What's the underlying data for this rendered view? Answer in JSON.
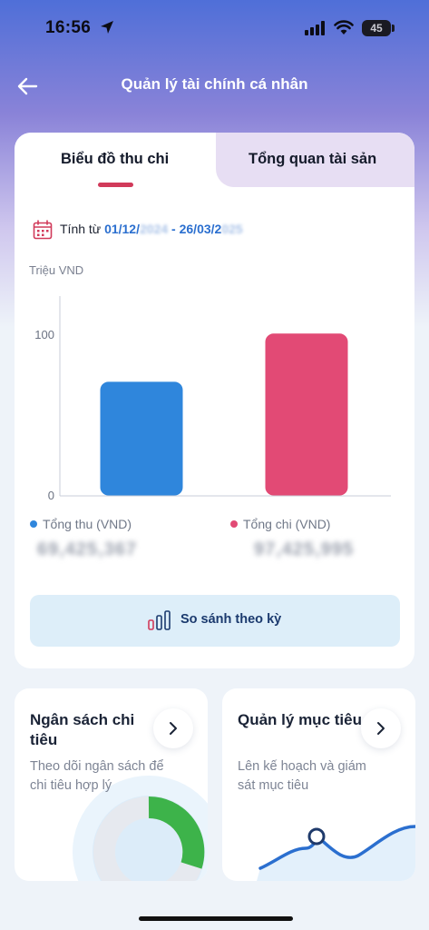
{
  "status_bar": {
    "time": "16:56",
    "battery": "45"
  },
  "header": {
    "title": "Quản lý tài chính cá nhân"
  },
  "tabs": [
    {
      "label": "Biểu đồ thu chi",
      "active": true
    },
    {
      "label": "Tổng quan tài sản",
      "active": false
    }
  ],
  "date_range": {
    "prefix": "Tính từ",
    "start": "01/12/",
    "start_hidden": "2024",
    "sep": " - ",
    "end": "26/03/2",
    "end_hidden": "025"
  },
  "chart_data": {
    "type": "bar",
    "ylabel": "Triệu VND",
    "yticks": [
      0,
      100
    ],
    "ylim": [
      0,
      130
    ],
    "categories": [
      "Tổng thu (VND)",
      "Tổng chi (VND)"
    ],
    "values": [
      71,
      101
    ],
    "colors": [
      "#2f86dc",
      "#e24a75"
    ],
    "grid": false,
    "legend": "bottom"
  },
  "totals": {
    "income_label": "Tổng thu (VND)",
    "income_value": "69,425,367",
    "expense_label": "Tổng chi (VND)",
    "expense_value": "97,425,995"
  },
  "compare_button": {
    "label": "So sánh theo kỳ"
  },
  "cards": [
    {
      "title": "Ngân sách chi tiêu",
      "desc": "Theo dõi ngân sách để chi tiêu hợp lý"
    },
    {
      "title": "Quản lý mục tiêu",
      "desc": "Lên kế hoạch và giám sát mục tiêu"
    }
  ],
  "colors": {
    "accent": "#d13a5a",
    "link_blue": "#2b6fcf",
    "income": "#2f86dc",
    "expense": "#e24a75",
    "donut_green": "#3db34a"
  }
}
